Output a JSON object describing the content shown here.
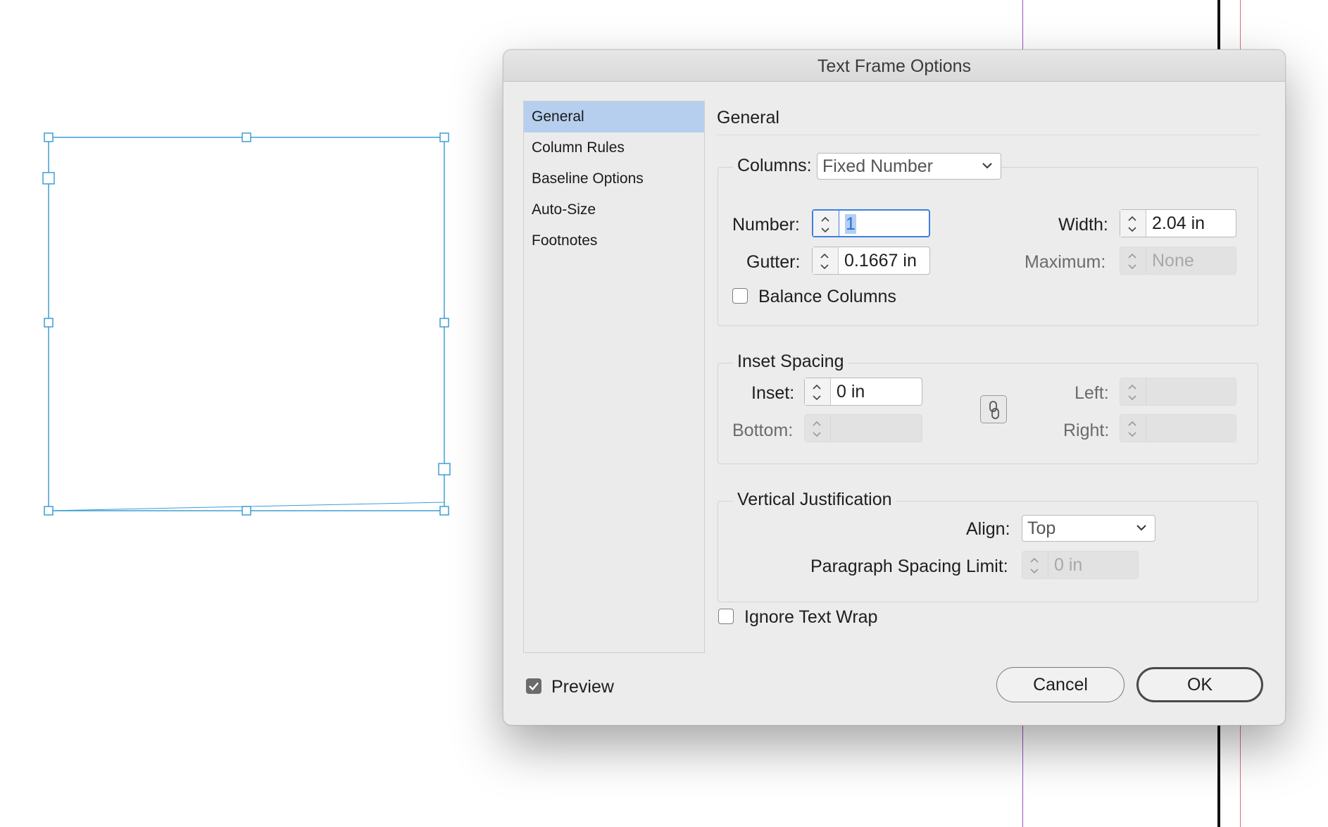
{
  "dialog": {
    "title": "Text Frame Options",
    "sidebar": {
      "items": [
        {
          "label": "General",
          "selected": true
        },
        {
          "label": "Column Rules",
          "selected": false
        },
        {
          "label": "Baseline Options",
          "selected": false
        },
        {
          "label": "Auto-Size",
          "selected": false
        },
        {
          "label": "Footnotes",
          "selected": false
        }
      ]
    },
    "section_title": "General",
    "columns": {
      "label": "Columns:",
      "mode": "Fixed Number",
      "number_label": "Number:",
      "number_value": "1",
      "gutter_label": "Gutter:",
      "gutter_value": "0.1667 in",
      "width_label": "Width:",
      "width_value": "2.04 in",
      "maximum_label": "Maximum:",
      "maximum_value": "None",
      "balance_label": "Balance Columns",
      "balance_checked": false
    },
    "inset_spacing": {
      "title": "Inset Spacing",
      "inset_label": "Inset:",
      "inset_value": "0 in",
      "bottom_label": "Bottom:",
      "bottom_value": "",
      "left_label": "Left:",
      "left_value": "",
      "right_label": "Right:",
      "right_value": "",
      "link_icon": "chain-link-icon"
    },
    "vertical_justification": {
      "title": "Vertical Justification",
      "align_label": "Align:",
      "align_value": "Top",
      "paragraph_spacing_label": "Paragraph Spacing Limit:",
      "paragraph_spacing_value": "0 in"
    },
    "ignore_text_wrap": {
      "label": "Ignore Text Wrap",
      "checked": false
    },
    "preview": {
      "label": "Preview",
      "checked": true
    },
    "buttons": {
      "cancel": "Cancel",
      "ok": "OK"
    }
  },
  "colors": {
    "selection_handle": "#3f9ed4",
    "sidebar_selected": "#b6cfee",
    "focus_ring": "#3d7fe0",
    "guide_purple": "#9b4fc9",
    "guide_red": "#e06b7a"
  }
}
